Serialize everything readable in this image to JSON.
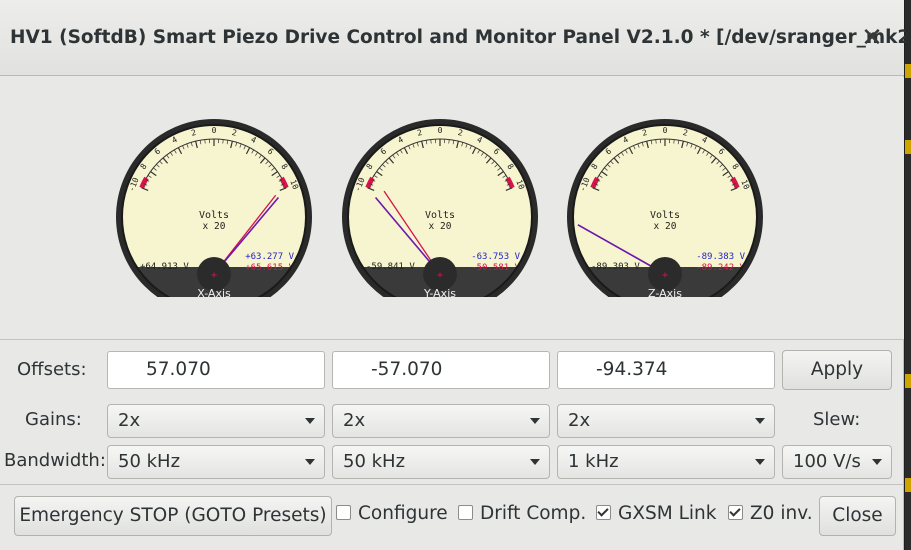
{
  "window": {
    "title": "HV1 (SoftdB) Smart Piezo Drive Control and Monitor Panel V2.1.0 * [/dev/sranger_mk2...",
    "close_glyph": "✕"
  },
  "meters": [
    {
      "axis": "X-Axis",
      "unit": "Volts",
      "scale": "x 20",
      "left_value": "+64.913 V",
      "right_top": "+63.277 V",
      "right_bottom": "+65.615 V",
      "needle_main": 0.59,
      "needle_second": 0.56
    },
    {
      "axis": "Y-Axis",
      "unit": "Volts",
      "scale": "x 20",
      "left_value": "-59.841 V",
      "right_top": "-63.753 V",
      "right_bottom": "-50.581 V",
      "needle_main": -0.59,
      "needle_second": -0.5
    },
    {
      "axis": "Z-Axis",
      "unit": "Volts",
      "scale": "x 20",
      "left_value": "-89.303 V",
      "right_top": "-89.383 V",
      "right_bottom": "-89.242 V",
      "needle_main": -0.89,
      "needle_second": -0.89
    }
  ],
  "scale_ticks": [
    "-10",
    "8",
    "6",
    "4",
    "2",
    "0",
    "2",
    "4",
    "6",
    "8",
    "10"
  ],
  "meter_plus": "+",
  "colors": {
    "needle": "#6a1ab0",
    "red": "#d4144a",
    "blue": "#2222cc",
    "face": "#f7f5cf"
  },
  "offsets": {
    "label": "Offsets:",
    "x": "57.070",
    "y": "-57.070",
    "z": "-94.374",
    "apply": "Apply"
  },
  "gains": {
    "label": "Gains:",
    "x": "2x",
    "y": "2x",
    "z": "2x",
    "slew_label": "Slew:"
  },
  "bandwidth": {
    "label": "Bandwidth:",
    "x": "50 kHz",
    "y": "50 kHz",
    "z": "1 kHz",
    "slew": "100 V/s"
  },
  "footer": {
    "emergency": "Emergency STOP (GOTO Presets)",
    "configure": {
      "label": "Configure",
      "checked": false
    },
    "drift": {
      "label": "Drift Comp.",
      "checked": false
    },
    "gxsm": {
      "label": "GXSM Link",
      "checked": true
    },
    "z0": {
      "label": "Z0 inv.",
      "checked": true
    },
    "close": "Close"
  }
}
